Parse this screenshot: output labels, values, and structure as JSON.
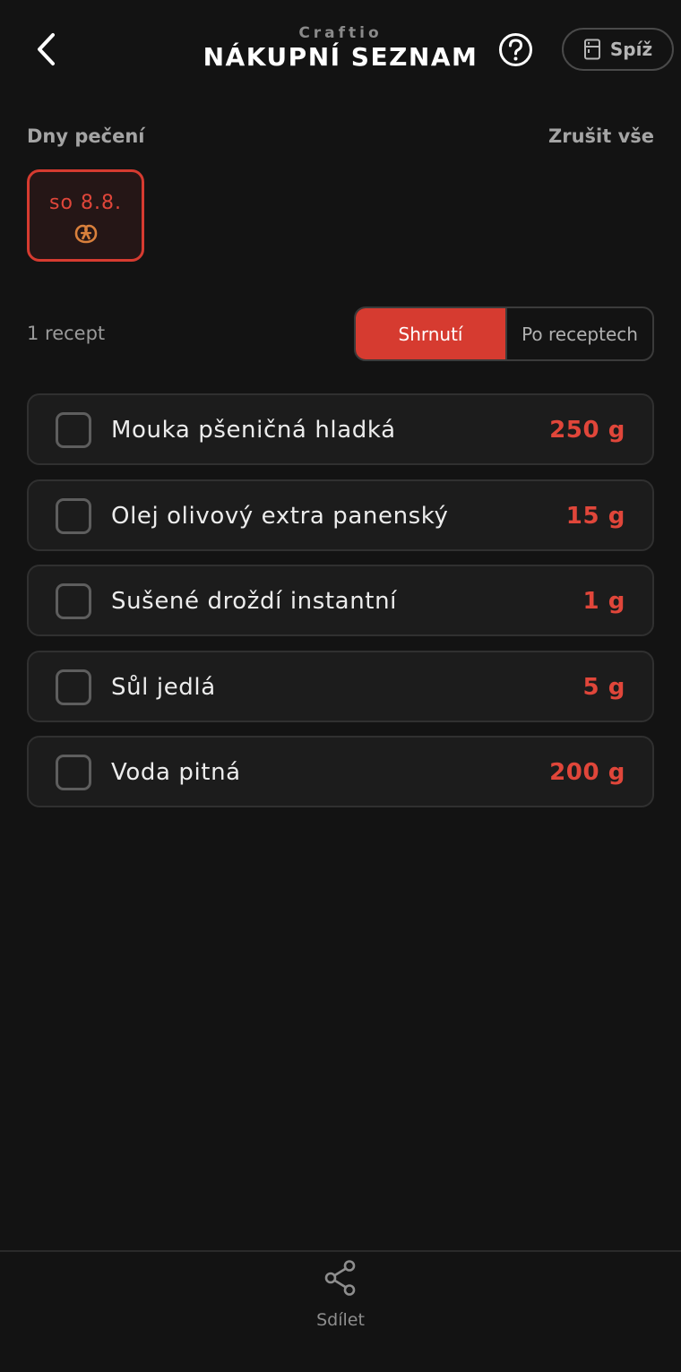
{
  "header": {
    "brand": "Craftio",
    "title": "NÁKUPNÍ SEZNAM",
    "pantry_label": "Spíž"
  },
  "baking_days": {
    "label": "Dny pečení",
    "cancel_all": "Zrušit vše",
    "days": [
      {
        "date": "so 8.8.",
        "icon": "pretzel-icon",
        "selected": true
      }
    ]
  },
  "summary": {
    "recipe_count": "1 recept",
    "tabs": [
      {
        "label": "Shrnutí",
        "active": true
      },
      {
        "label": "Po receptech",
        "active": false
      }
    ]
  },
  "items": [
    {
      "name": "Mouka pšeničná hladká",
      "amount": "250 g",
      "checked": false
    },
    {
      "name": "Olej olivový extra panenský",
      "amount": "15 g",
      "checked": false
    },
    {
      "name": "Sušené droždí instantní",
      "amount": "1 g",
      "checked": false
    },
    {
      "name": "Sůl jedlá",
      "amount": "5 g",
      "checked": false
    },
    {
      "name": "Voda pitná",
      "amount": "200 g",
      "checked": false
    }
  ],
  "bottom_bar": {
    "share_label": "Sdílet"
  },
  "colors": {
    "background": "#131313",
    "accent": "#d63b30",
    "card": "#1c1c1c"
  }
}
